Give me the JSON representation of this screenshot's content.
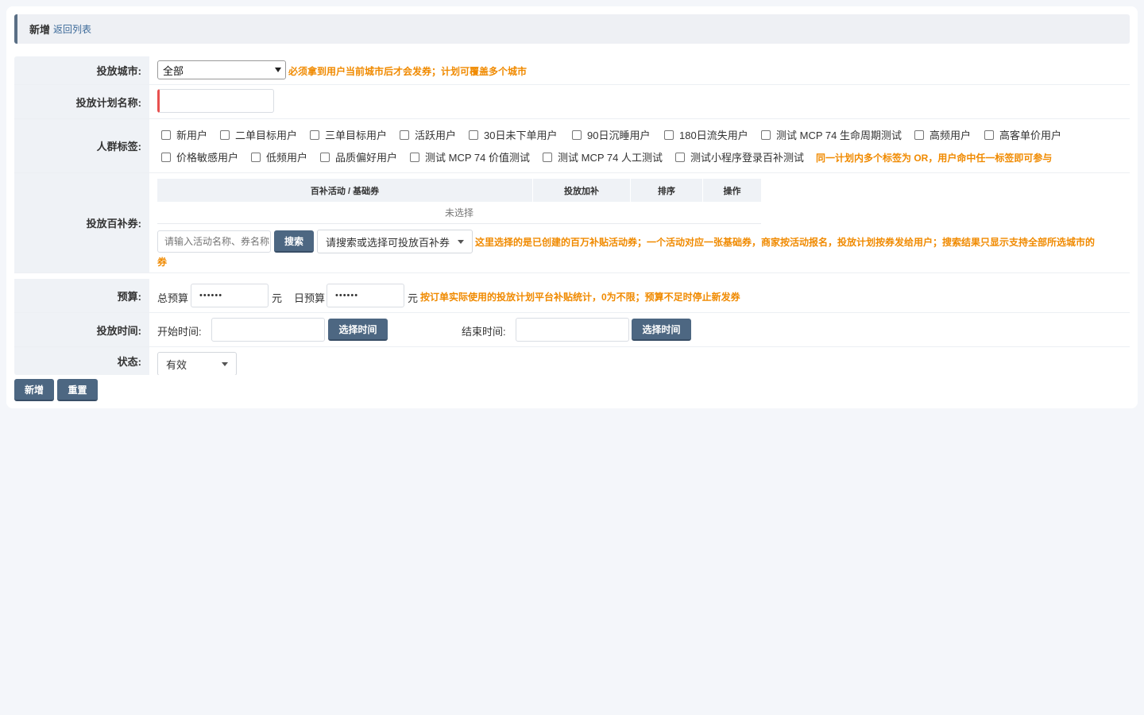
{
  "header": {
    "title": "新增",
    "back_link": "返回列表"
  },
  "city": {
    "label": "投放城市:",
    "selected": "全部",
    "hint": "必须拿到用户当前城市后才会发券；计划可覆盖多个城市"
  },
  "plan_name": {
    "label": "投放计划名称:",
    "value": ""
  },
  "crowd": {
    "label": "人群标签:",
    "tags_row1": [
      "新用户",
      "二单目标用户",
      "三单目标用户",
      "活跃用户",
      "30日未下单用户",
      "90日沉睡用户",
      "180日流失用户",
      "测试 MCP 74 生命周期测试",
      "高频用户",
      "高客单价用户"
    ],
    "tags_row2": [
      "价格敏感用户",
      "低频用户",
      "品质偏好用户",
      "测试 MCP 74 价值测试",
      "测试 MCP 74 人工测试",
      "测试小程序登录百补测试"
    ],
    "hint": "同一计划内多个标签为 OR，用户命中任一标签即可参与"
  },
  "coupon": {
    "label": "投放百补券:",
    "columns": [
      "百补活动 / 基础券",
      "投放加补",
      "排序",
      "操作"
    ],
    "empty_text": "未选择",
    "search_placeholder": "请输入活动名称、券名称",
    "search_button": "搜索",
    "select_placeholder": "请搜索或选择可投放百补券",
    "hint_line1": "这里选择的是已创建的百万补贴活动券；一个活动对应一张基础券，商家按活动报名，投放计划按券发给用户；搜索结果只显示支持全部所选城市的",
    "hint_line2": "券"
  },
  "budget": {
    "label": "预算:",
    "total_label": "总预算",
    "total_value": "••••••",
    "unit1": "元",
    "daily_label": "日预算",
    "daily_value": "••••••",
    "unit2": "元",
    "hint": "按订单实际使用的投放计划平台补贴统计，0为不限；预算不足时停止新发券"
  },
  "time": {
    "label": "投放时间:",
    "start_label": "开始时间:",
    "start_button": "选择时间",
    "end_label": "结束时间:",
    "end_button": "选择时间"
  },
  "status": {
    "label": "状态:",
    "selected": "有效"
  },
  "actions": {
    "add": "新增",
    "reset": "重置"
  },
  "colors": {
    "accent": "#4d6782",
    "hint": "#f08a00",
    "required": "#e8504f"
  }
}
